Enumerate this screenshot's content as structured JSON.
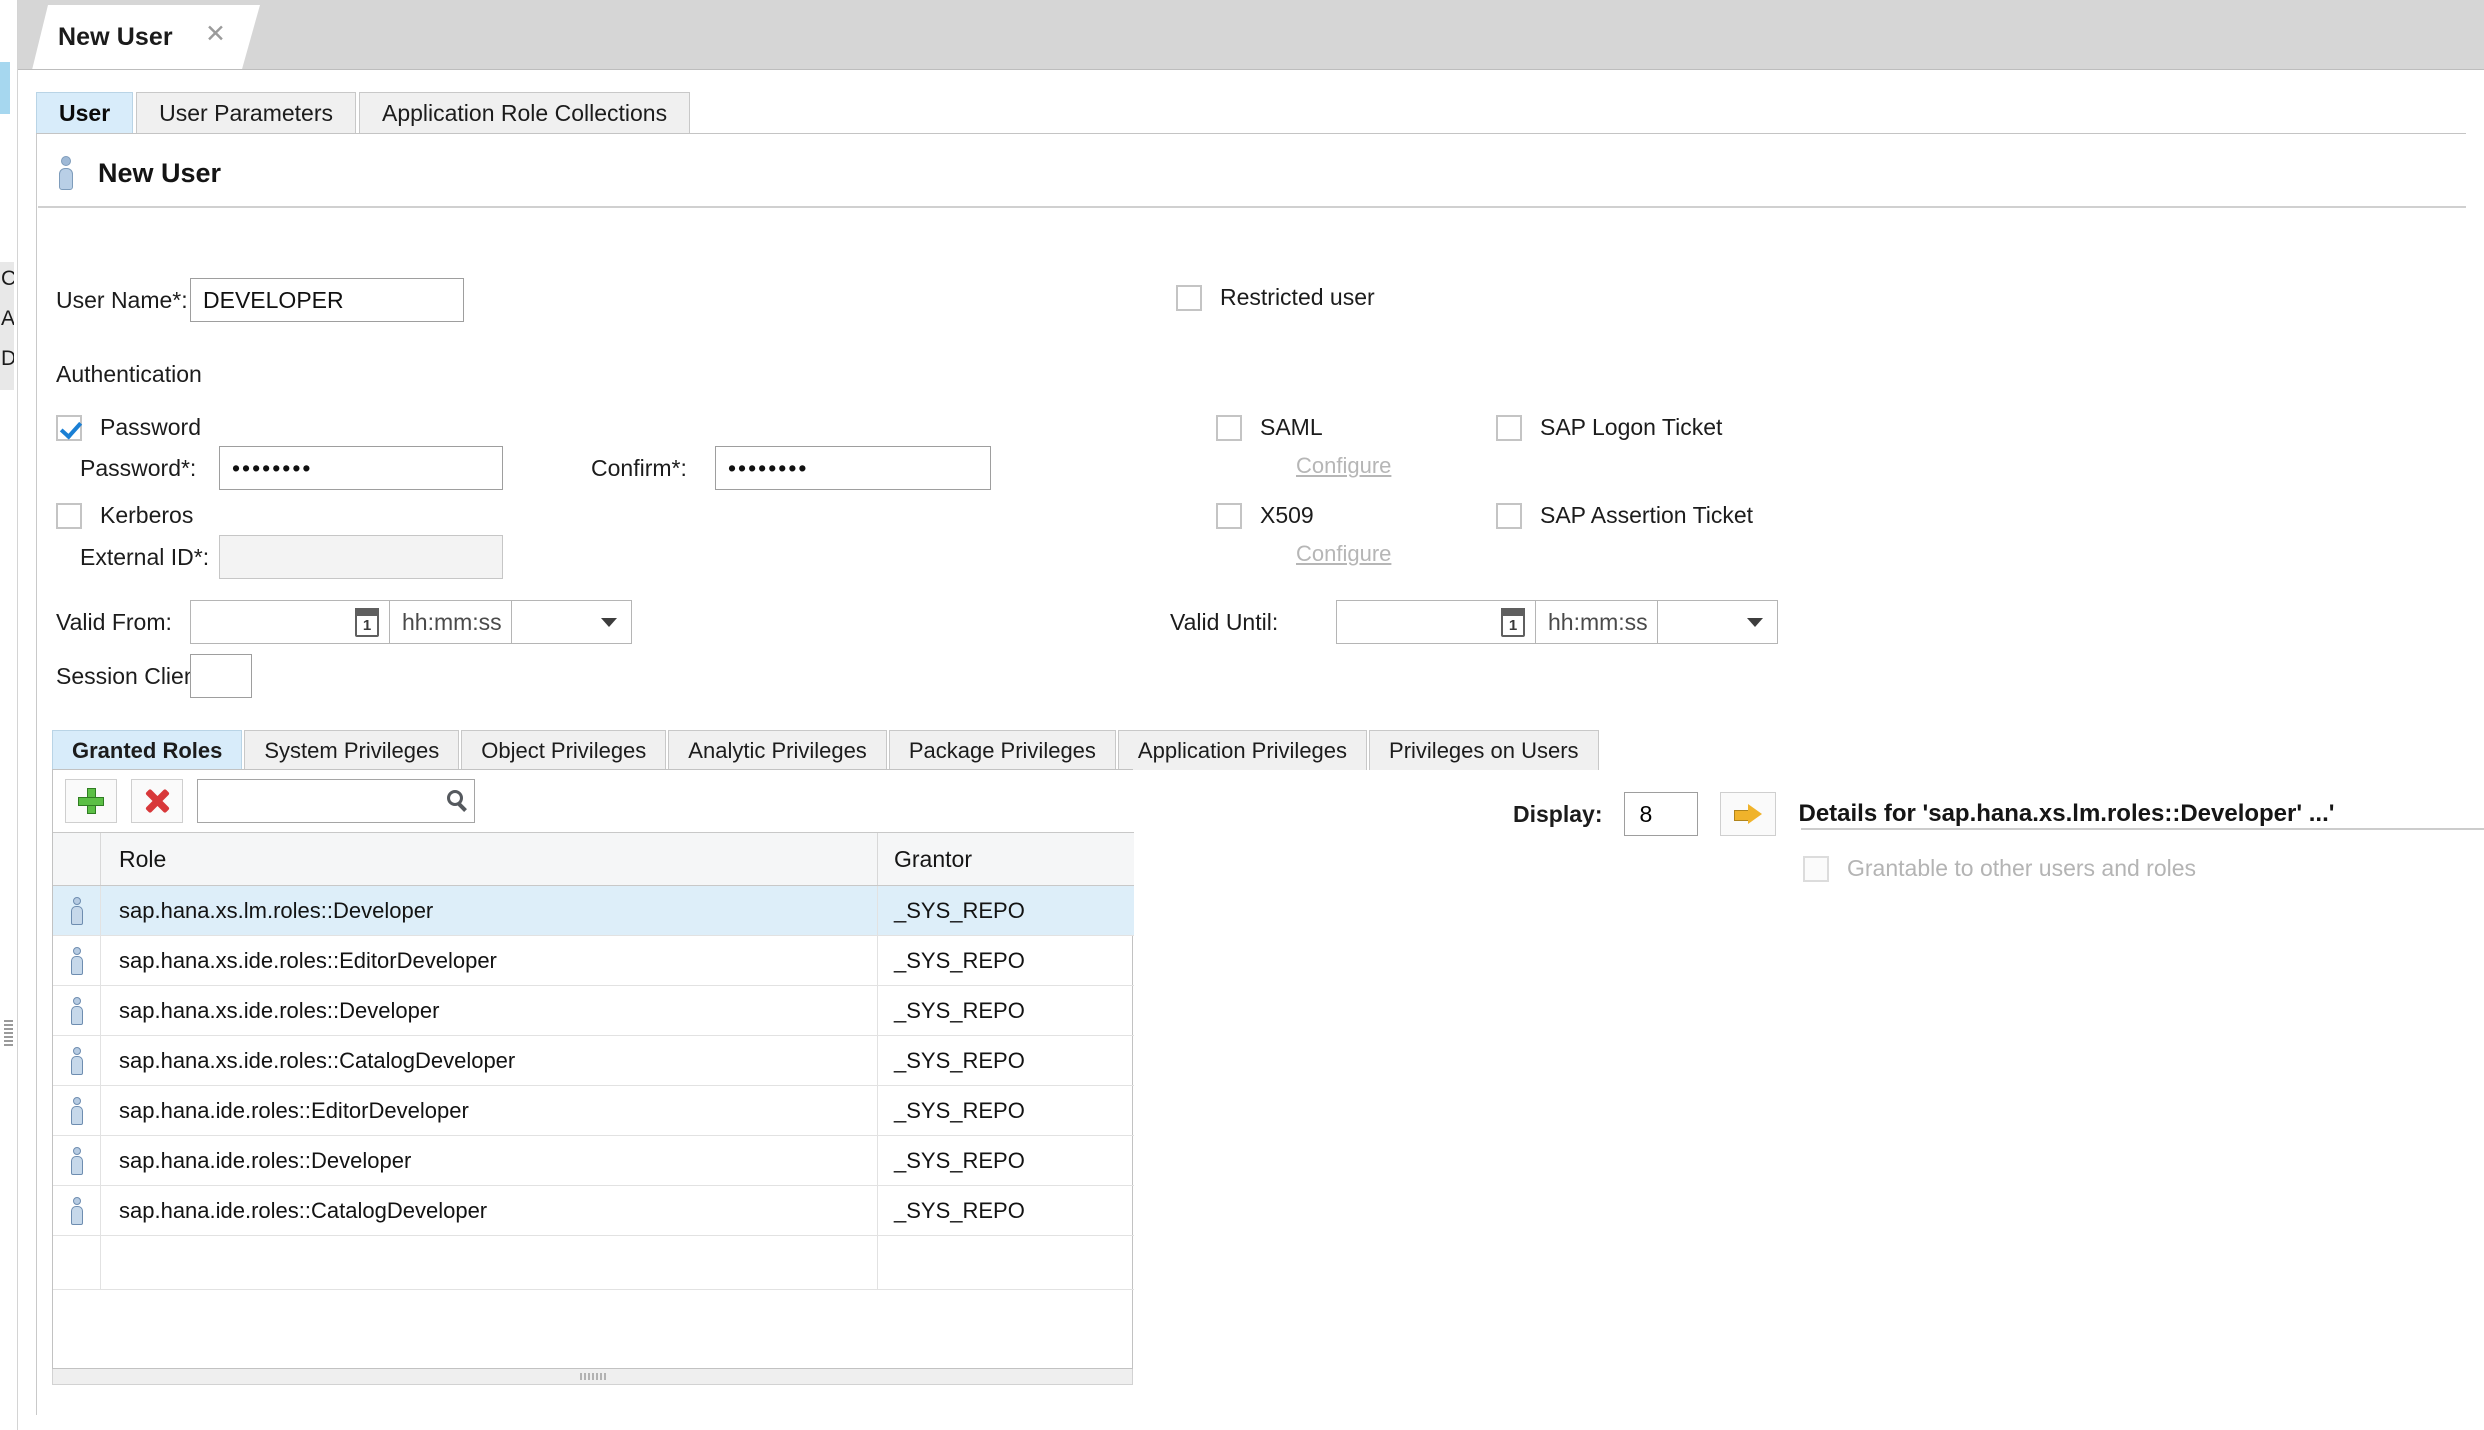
{
  "window": {
    "editor_tab_title": "New User",
    "close_icon": "close-icon"
  },
  "top_tabs": [
    {
      "label": "User",
      "active": true
    },
    {
      "label": "User Parameters",
      "active": false
    },
    {
      "label": "Application Role Collections",
      "active": false
    }
  ],
  "page": {
    "title": "New User",
    "icon": "user-icon"
  },
  "form": {
    "user_name_label": "User Name*:",
    "user_name_value": "DEVELOPER",
    "restricted_user_label": "Restricted user",
    "restricted_user_checked": false,
    "authentication_label": "Authentication",
    "password_label": "Password",
    "password_checked": true,
    "password_field_label": "Password*:",
    "password_value": "••••••••",
    "confirm_label": "Confirm*:",
    "confirm_value": "••••••••",
    "kerberos_label": "Kerberos",
    "kerberos_checked": false,
    "external_id_label": "External ID*:",
    "external_id_value": "",
    "saml_label": "SAML",
    "saml_checked": false,
    "saml_configure_label": "Configure",
    "x509_label": "X509",
    "x509_checked": false,
    "x509_configure_label": "Configure",
    "sap_logon_ticket_label": "SAP Logon Ticket",
    "sap_logon_ticket_checked": false,
    "sap_assertion_ticket_label": "SAP Assertion Ticket",
    "sap_assertion_ticket_checked": false,
    "valid_from_label": "Valid From:",
    "valid_from_date": "",
    "valid_from_time_placeholder": "hh:mm:ss",
    "valid_from_zone": "",
    "valid_until_label": "Valid Until:",
    "valid_until_date": "",
    "valid_until_time_placeholder": "hh:mm:ss",
    "valid_until_zone": "",
    "session_client_label": "Session Client:",
    "session_client_value": ""
  },
  "privilege_tabs": [
    {
      "label": "Granted Roles",
      "active": true
    },
    {
      "label": "System Privileges",
      "active": false
    },
    {
      "label": "Object Privileges",
      "active": false
    },
    {
      "label": "Analytic Privileges",
      "active": false
    },
    {
      "label": "Package Privileges",
      "active": false
    },
    {
      "label": "Application Privileges",
      "active": false
    },
    {
      "label": "Privileges on Users",
      "active": false
    }
  ],
  "roles_toolbar": {
    "add_icon": "plus-icon",
    "remove_icon": "x-mark-icon",
    "search_value": "",
    "search_placeholder": "",
    "search_icon": "search-icon"
  },
  "roles_table": {
    "columns": [
      "Role",
      "Grantor"
    ],
    "rows": [
      {
        "icon": "role-icon",
        "role": "sap.hana.xs.lm.roles::Developer",
        "grantor": "_SYS_REPO",
        "selected": true
      },
      {
        "icon": "role-icon",
        "role": "sap.hana.xs.ide.roles::EditorDeveloper",
        "grantor": "_SYS_REPO",
        "selected": false
      },
      {
        "icon": "role-icon",
        "role": "sap.hana.xs.ide.roles::Developer",
        "grantor": "_SYS_REPO",
        "selected": false
      },
      {
        "icon": "role-icon",
        "role": "sap.hana.xs.ide.roles::CatalogDeveloper",
        "grantor": "_SYS_REPO",
        "selected": false
      },
      {
        "icon": "role-icon",
        "role": "sap.hana.ide.roles::EditorDeveloper",
        "grantor": "_SYS_REPO",
        "selected": false
      },
      {
        "icon": "role-icon",
        "role": "sap.hana.ide.roles::Developer",
        "grantor": "_SYS_REPO",
        "selected": false
      },
      {
        "icon": "role-icon",
        "role": "sap.hana.ide.roles::CatalogDeveloper",
        "grantor": "_SYS_REPO",
        "selected": false
      }
    ]
  },
  "details": {
    "display_label": "Display:",
    "display_value": "8",
    "go_icon": "arrow-right-icon",
    "title": "Details for 'sap.hana.xs.lm.roles::Developer' ...'",
    "grantable_label": "Grantable to other users and roles",
    "grantable_checked": false,
    "grantable_disabled": true
  },
  "left_strip": {
    "glyphs": [
      "C",
      "A",
      "D"
    ]
  },
  "colors": {
    "active_tab": "#d8ecfa",
    "selected_row": "#ddeef9",
    "checkbox_check": "#1a7fd4",
    "add_green": "#5cbf46",
    "remove_red": "#d8383a",
    "arrow_gold": "#f0b32b",
    "chrome_gray": "#d6d6d6"
  }
}
